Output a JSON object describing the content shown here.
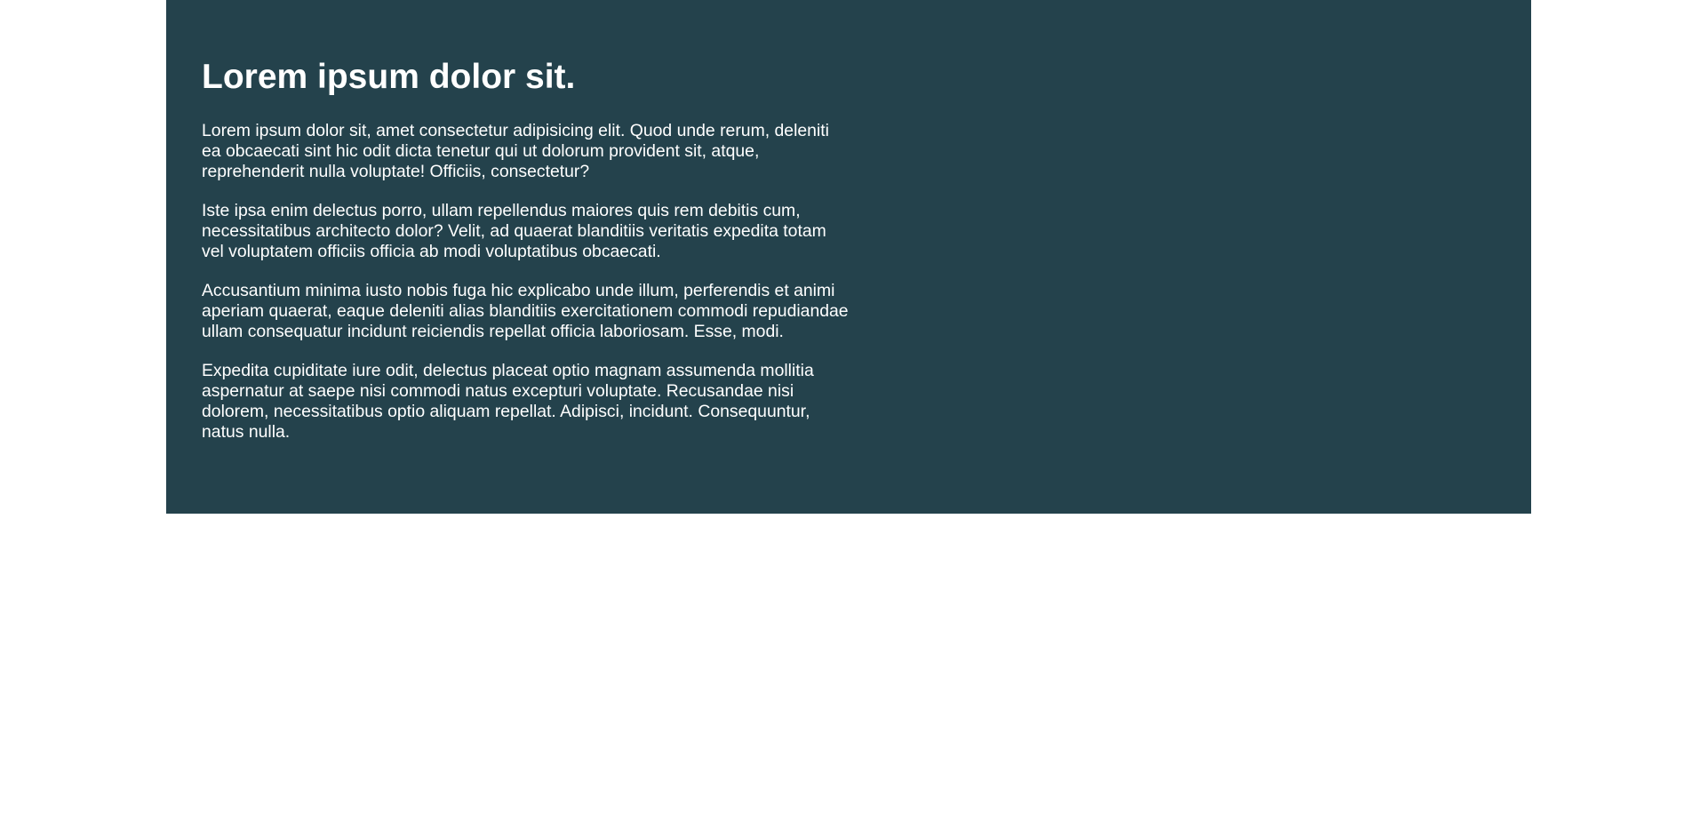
{
  "heading": "Lorem ipsum dolor sit.",
  "paragraphs": [
    "Lorem ipsum dolor sit, amet consectetur adipisicing elit. Quod unde rerum, deleniti ea obcaecati sint hic odit dicta tenetur qui ut dolorum provident sit, atque, reprehenderit nulla voluptate! Officiis, consectetur?",
    "Iste ipsa enim delectus porro, ullam repellendus maiores quis rem debitis cum, necessitatibus architecto dolor? Velit, ad quaerat blanditiis veritatis expedita totam vel voluptatem officiis officia ab modi voluptatibus obcaecati.",
    "Accusantium minima iusto nobis fuga hic explicabo unde illum, perferendis et animi aperiam quaerat, eaque deleniti alias blanditiis exercitationem commodi repudiandae ullam consequatur incidunt reiciendis repellat officia laboriosam. Esse, modi.",
    "Expedita cupiditate iure odit, delectus placeat optio magnam assumenda mollitia aspernatur at saepe nisi commodi natus excepturi voluptate. Recusandae nisi dolorem, necessitatibus optio aliquam repellat. Adipisci, incidunt. Consequuntur, natus nulla."
  ],
  "colors": {
    "panel_bg": "#24424c",
    "text": "#ffffff"
  }
}
